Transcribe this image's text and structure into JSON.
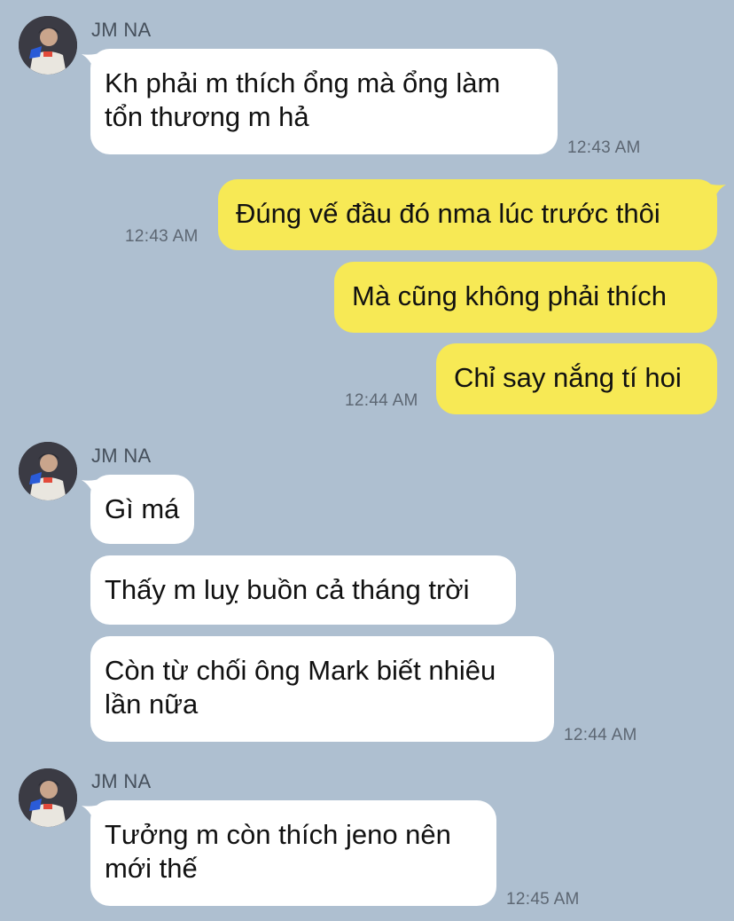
{
  "groups": [
    {
      "sender": "JM NA",
      "messages": [
        {
          "lines": [
            "Kh phải m thích ổng mà ổng làm",
            "tổn thương m hả"
          ]
        }
      ],
      "time": "12:43 AM"
    },
    {
      "sender": "",
      "outgoing": true,
      "messages": [
        {
          "lines": [
            "Đúng vế đầu đó nma lúc trước thôi"
          ],
          "time": "12:43 AM"
        },
        {
          "lines": [
            "Mà cũng không phải thích"
          ]
        },
        {
          "lines": [
            "Chỉ say nắng tí hoi"
          ],
          "time": "12:44 AM"
        }
      ]
    },
    {
      "sender": "JM NA",
      "messages": [
        {
          "lines": [
            "Gì má"
          ]
        },
        {
          "lines": [
            "Thấy m luỵ buồn cả tháng trời"
          ]
        },
        {
          "lines": [
            "Còn từ chối ông Mark biết nhiêu",
            "lần nữa"
          ]
        }
      ],
      "time": "12:44 AM"
    },
    {
      "sender": "JM NA",
      "messages": [
        {
          "lines": [
            "Tưởng m còn thích jeno nên",
            "mới thế"
          ]
        }
      ],
      "time": "12:45 AM"
    }
  ],
  "colors": {
    "background": "#aebfd0",
    "incoming_bubble": "#ffffff",
    "outgoing_bubble": "#f7e955",
    "timestamp": "#5d6773"
  },
  "icons": {
    "avatar": "avatar-photo"
  }
}
